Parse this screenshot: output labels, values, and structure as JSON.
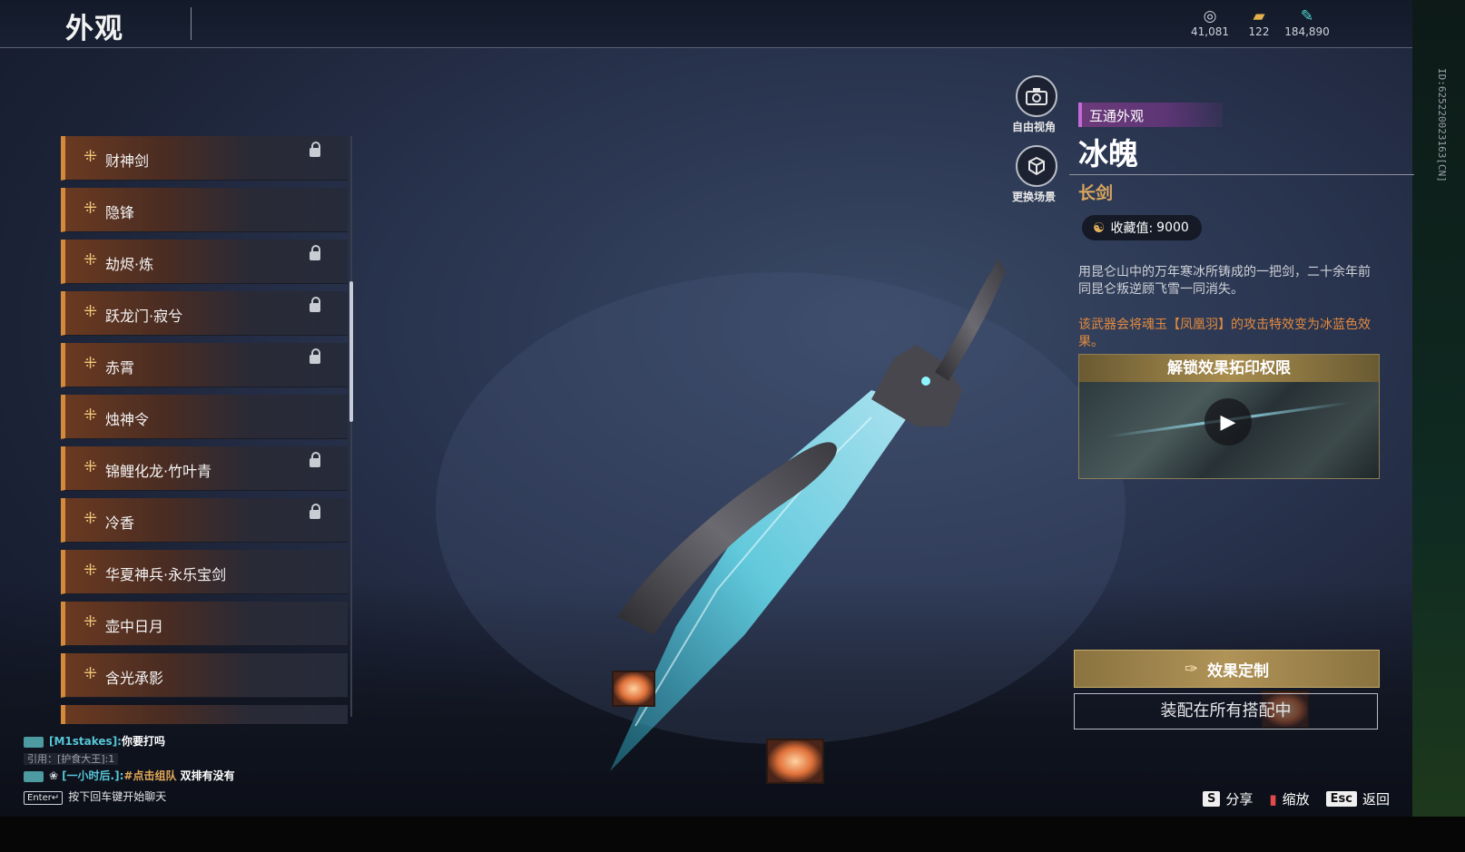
{
  "header": {
    "title": "外观",
    "currencies": [
      {
        "icon": "coin-icon",
        "value": "41,081"
      },
      {
        "icon": "gold-ticket-icon",
        "value": "122"
      },
      {
        "icon": "feather-icon",
        "value": "184,890"
      }
    ]
  },
  "side_id": "ID:625220023163[CN]",
  "camera": {
    "free_view_label": "自由视角",
    "change_scene_label": "更换场景"
  },
  "list": {
    "items": [
      {
        "label": "财神剑",
        "locked": true
      },
      {
        "label": "隐锋",
        "locked": false
      },
      {
        "label": "劫烬·炼",
        "locked": true
      },
      {
        "label": "跃龙门·寂兮",
        "locked": true
      },
      {
        "label": "赤霄",
        "locked": true
      },
      {
        "label": "烛神令",
        "locked": false
      },
      {
        "label": "锦鲤化龙·竹叶青",
        "locked": true
      },
      {
        "label": "冷香",
        "locked": true
      },
      {
        "label": "华夏神兵·永乐宝剑",
        "locked": false
      },
      {
        "label": "壶中日月",
        "locked": false
      },
      {
        "label": "含光承影",
        "locked": false
      }
    ]
  },
  "detail": {
    "tag": "互通外观",
    "name": "冰魄",
    "type": "长剑",
    "collect_label": "收藏值:",
    "collect_value": "9000",
    "description": "用昆仑山中的万年寒冰所铸成的一把剑，二十余年前同昆仑叛逆顾飞雪一同消失。",
    "effect_note": "该武器会将魂玉【凤凰羽】的攻击特效变为冰蓝色效果。",
    "unlock_title": "解锁效果拓印权限",
    "custom_button": "效果定制",
    "equip_button": "装配在所有搭配中"
  },
  "chat": {
    "line1_name": "[M1stakes]:",
    "line1_msg": "你要打吗",
    "line2_ref": "引用：[护食大王]:1",
    "line3_name": "[一小时后.]:",
    "line3_link": "#点击组队",
    "line3_msg": " 双排有没有",
    "enter_key": "Enter↵",
    "hint": "按下回车键开始聊天"
  },
  "hotkeys": [
    {
      "key": "S",
      "label": "分享"
    },
    {
      "key": "",
      "label": "缩放"
    },
    {
      "key": "Esc",
      "label": "返回"
    }
  ],
  "colors": {
    "accent_orange": "#d48a3d",
    "tag_purple": "#6c3a7a",
    "gold": "#b09357",
    "ice_blue": "#59d3e6"
  }
}
